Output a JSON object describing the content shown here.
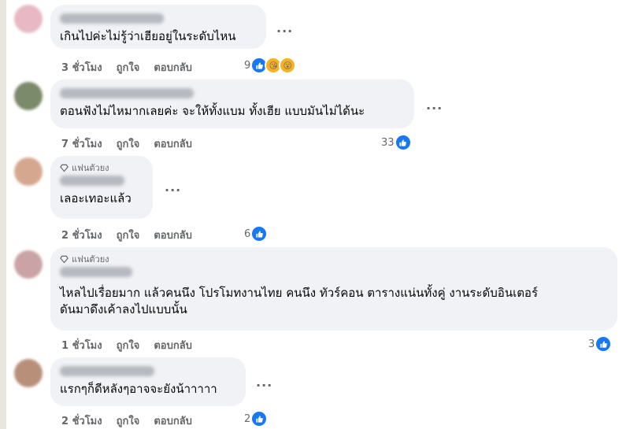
{
  "fan_badge": "แฟนตัวยง",
  "comments": [
    {
      "text": "เกินไปค่ะไม่รู้ว่าเฮียอยู่ในระดับไหน",
      "time": "3 ชั่วโมง",
      "like": "ถูกใจ",
      "reply": "ตอบกลับ",
      "count": "9",
      "reactions": [
        "like-icon",
        "haha-icon",
        "wow-icon"
      ],
      "more": "..."
    },
    {
      "text": "ตอนฟังไม่ไหมากเลยค่ะ จะให้ทั้งแบม ทั้งเฮีย แบบมันไม่ได้นะ",
      "time": "7 ชั่วโมง",
      "like": "ถูกใจ",
      "reply": "ตอบกลับ",
      "count": "33",
      "reactions": [
        "like-icon"
      ],
      "more": "..."
    },
    {
      "text": "เลอะเทอะแล้ว",
      "time": "2 ชั่วโมง",
      "like": "ถูกใจ",
      "reply": "ตอบกลับ",
      "count": "6",
      "reactions": [
        "like-icon"
      ],
      "more": "...",
      "fan": true
    },
    {
      "text_lines": [
        "ไหลไปเรื่อยมาก แล้วคนนึง โปรโมทงานไทย คนนึง ทัวร์คอน ตารางแน่นทั้งคู่ งานระดับอินเตอร์",
        "ดันมาดึงเค้าลงไปแบบนั้น"
      ],
      "time": "1 ชั่วโมง",
      "like": "ถูกใจ",
      "reply": "ตอบกลับ",
      "count": "3",
      "reactions": [
        "like-icon"
      ],
      "fan": true
    },
    {
      "text": "แรกๆก็ดีหลังๆอาจจะยังน้าาาาา",
      "time": "2 ชั่วโมง",
      "like": "ถูกใจ",
      "reply": "ตอบกลับ",
      "count": "2",
      "reactions": [
        "like-icon"
      ],
      "more": "..."
    }
  ]
}
